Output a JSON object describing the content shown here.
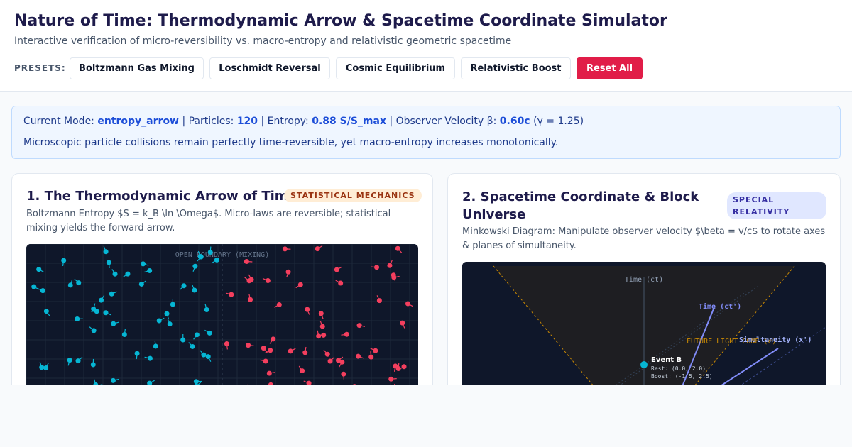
{
  "header": {
    "title": "Nature of Time: Thermodynamic Arrow & Spacetime Coordinate Simulator",
    "subtitle": "Interactive verification of micro-reversibility vs. macro-entropy and relativistic geometric spacetime",
    "presets_label": "PRESETS:",
    "presets": [
      "Boltzmann Gas Mixing",
      "Loschmidt Reversal",
      "Cosmic Equilibrium",
      "Relativistic Boost"
    ],
    "reset_label": "Reset All"
  },
  "status": {
    "mode_label": "Current Mode:",
    "mode_value": "entropy_arrow",
    "particles_label": "| Particles:",
    "particles_value": "120",
    "entropy_label": "| Entropy:",
    "entropy_value": "0.88 S/S_max",
    "velocity_label": "| Observer Velocity β:",
    "velocity_value": "0.60c",
    "gamma_text": "(γ = 1.25)",
    "message": "Microscopic particle collisions remain perfectly time-reversible, yet macro-entropy increases monotonically."
  },
  "colors": {
    "accent": "#1d4ed8",
    "danger": "#e11d48",
    "viz_bg": "#0f172a",
    "particle_cold": "#06b6d4",
    "particle_hot": "#f43f5e",
    "axis_primed": "#818cf8",
    "light_cone": "#ca8a04"
  },
  "panel1": {
    "title": "1. The Thermodynamic Arrow of Time",
    "badge": "STATISTICAL MECHANICS",
    "description": "Boltzmann Entropy $S = k_B \\ln \\Omega$. Micro-laws are reversible; statistical mixing yields the forward arrow.",
    "canvas_label": "OPEN BOUNDARY (MIXING)"
  },
  "panel2": {
    "title": "2. Spacetime Coordinate & Block Universe",
    "badge": "SPECIAL RELATIVITY",
    "description": "Minkowski Diagram: Manipulate observer velocity $\\beta = v/c$ to rotate axes & planes of simultaneity.",
    "axis_time": "Time (ct)",
    "axis_time_prime": "Time (ct')",
    "axis_simultaneity": "Simultaneity (x')",
    "light_cone_label": "FUTURE LIGHT CONE (c)",
    "event_name": "Event B",
    "event_rest": "Rest: (0.0, 2.0)",
    "event_boost": "Boost: (-1.5, 2.5)",
    "beta": 0.6
  }
}
